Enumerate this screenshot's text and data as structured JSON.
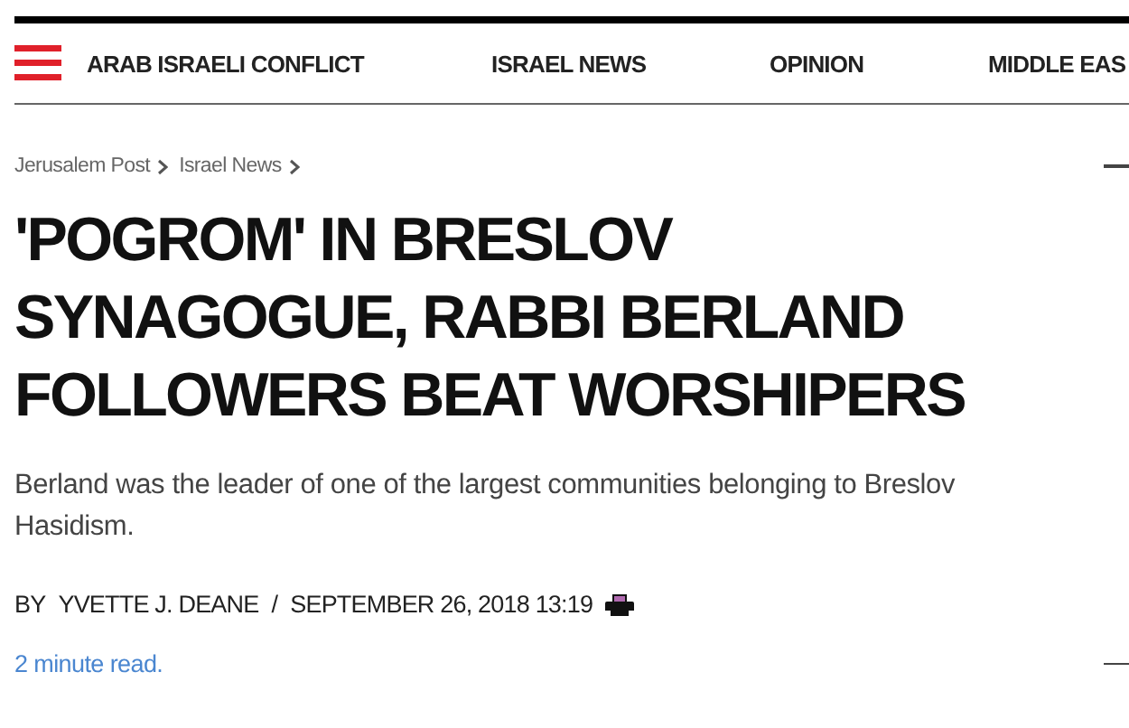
{
  "nav": {
    "items": [
      "ARAB ISRAELI CONFLICT",
      "ISRAEL NEWS",
      "OPINION",
      "MIDDLE EAS"
    ]
  },
  "breadcrumb": [
    "Jerusalem Post",
    "Israel News"
  ],
  "article": {
    "headline": "'POGROM' IN BRESLOV SYNAGOGUE, RABBI BERLAND FOLLOWERS BEAT WORSHIPERS",
    "summary": "Berland was the leader of one of the largest communities belonging to Breslov Hasidism.",
    "byline": {
      "prefix": "BY",
      "author": "YVETTE J. DEANE",
      "separator": "/",
      "date": "SEPTEMBER 26, 2018 13:19"
    },
    "read_time": "2 minute read."
  }
}
